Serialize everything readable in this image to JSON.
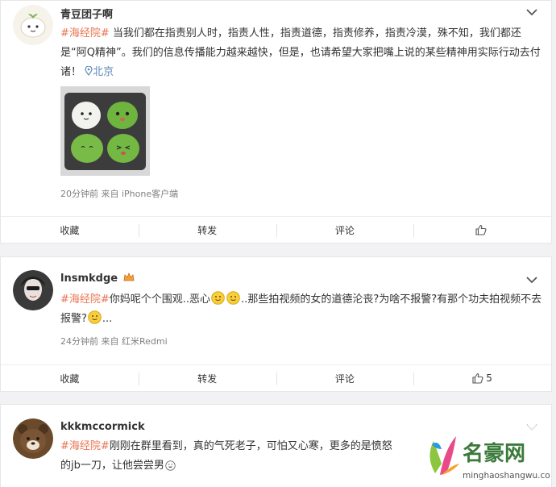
{
  "posts": [
    {
      "author": "青豆团子啊",
      "topic": "#海经院#",
      "text": " 当我们都在指责别人时，指责人性，指责道德，指责修养，指责冷漠，殊不知，我们都还是“阿Q精神”。我们的信息传播能力越来越快，但是，也请希望大家把嘴上说的某些精神用实际行动去付诸！",
      "location": "北京",
      "meta": "20分钟前 来自 iPhone客户端",
      "actions": {
        "favorite": "收藏",
        "repost": "转发",
        "comment": "评论",
        "like_count": ""
      }
    },
    {
      "author": "lnsmkdge",
      "topic": "#海经院#",
      "text_a": "你妈呢个个围观..恶心",
      "text_b": "..那些拍视频的女的道德沦丧?为啥不报警?有那个功夫拍视频不去报警?",
      "text_c": "...",
      "meta": "24分钟前 来自 红米Redmi",
      "actions": {
        "favorite": "收藏",
        "repost": "转发",
        "comment": "评论",
        "like_count": "5"
      }
    },
    {
      "author": "kkkmccormick",
      "topic": "#海经院#",
      "text_a": "刚刚在群里看到，真的气死老子，可怕又心寒，更多的是愤怒",
      "text_b": "的jb一刀，让他尝尝男"
    }
  ],
  "watermark": {
    "brand": "名豪网",
    "url": "minghaoshangwu.com"
  },
  "colors": {
    "topic": "#eb7350",
    "location": "#5d8ab5",
    "meta": "#808080",
    "brand": "#3a7a3a"
  }
}
